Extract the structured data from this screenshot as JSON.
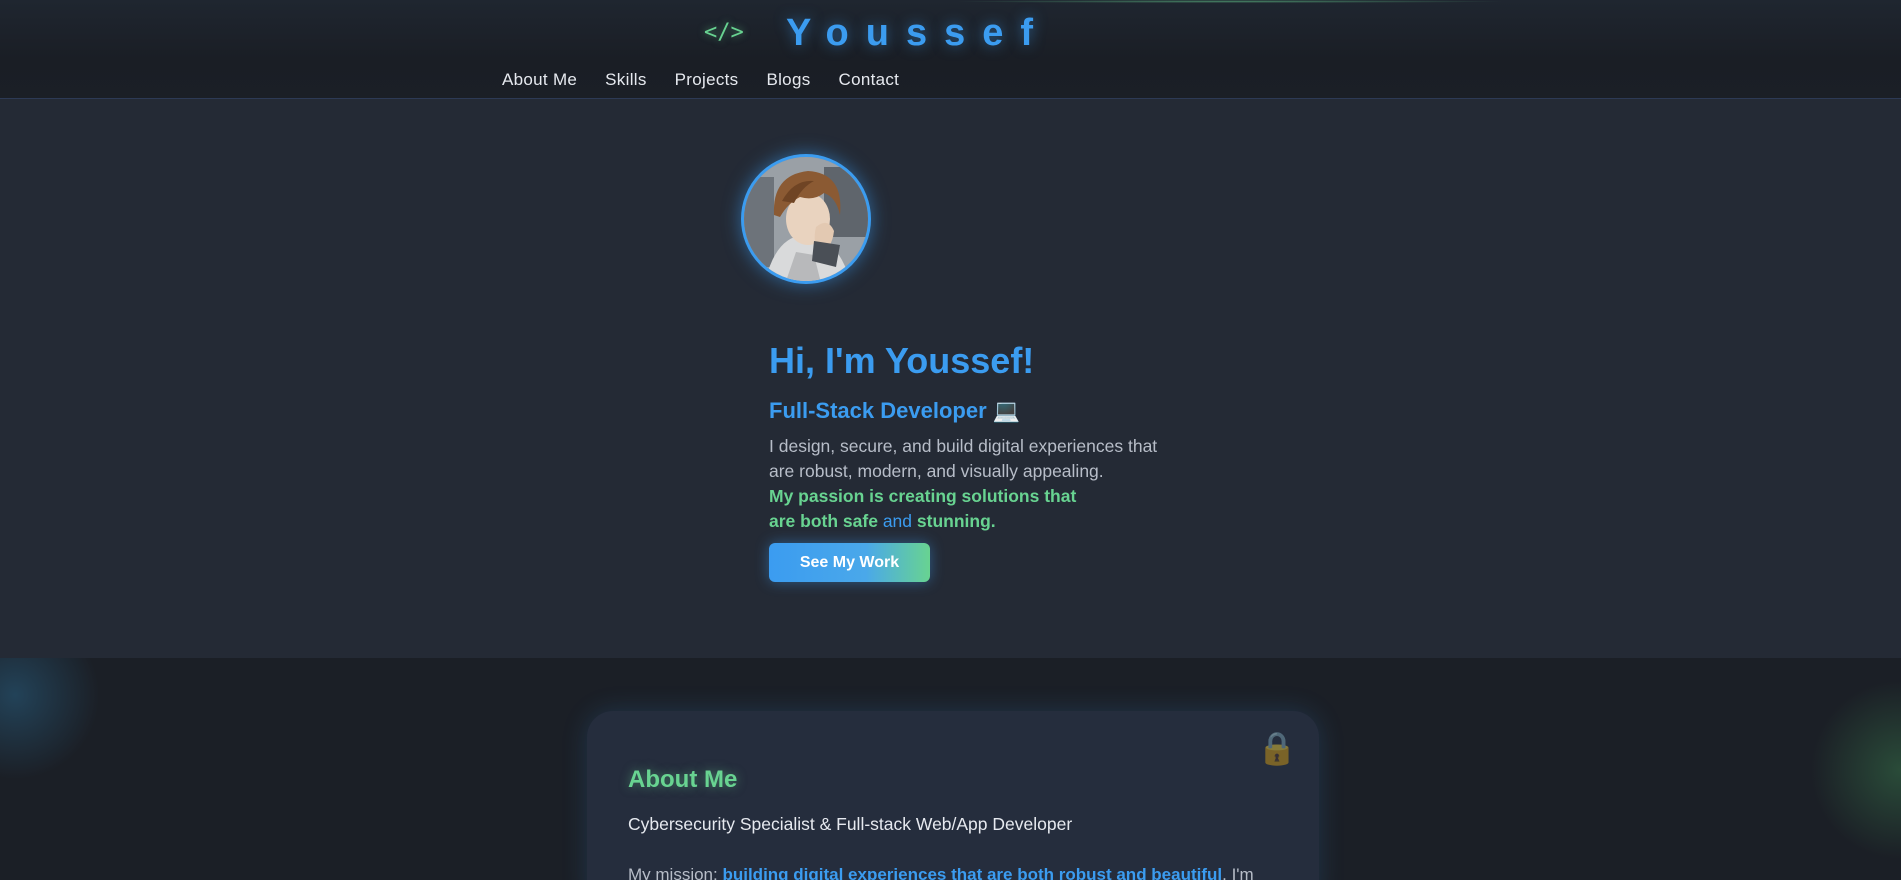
{
  "header": {
    "logo_glyph": "</>",
    "brand": "Youssef",
    "nav": [
      {
        "label": "About Me"
      },
      {
        "label": "Skills"
      },
      {
        "label": "Projects"
      },
      {
        "label": "Blogs"
      },
      {
        "label": "Contact"
      }
    ]
  },
  "hero": {
    "title": "Hi, I'm Youssef!",
    "role": "Full-Stack Developer",
    "role_icon": "💻",
    "description": "I design, secure, and build digital experiences that are robust, modern, and visually appealing.",
    "passion_part1": "My passion is creating solutions that are both safe",
    "passion_and": "and",
    "passion_part2": "stunning.",
    "cta_label": "See My Work"
  },
  "about": {
    "title": "About Me",
    "subtitle": "Cybersecurity Specialist & Full-stack Web/App Developer",
    "mission_prefix": "My mission:",
    "mission_highlight": "building digital experiences that are both robust and beautiful",
    "mission_suffix": ". I'm",
    "lock_icon": "🔒"
  },
  "colors": {
    "accent_blue": "#3b9cf0",
    "accent_green": "#68d391",
    "background": "#1b1f26",
    "hero_background": "#242a35",
    "card_background": "#252d3d"
  }
}
